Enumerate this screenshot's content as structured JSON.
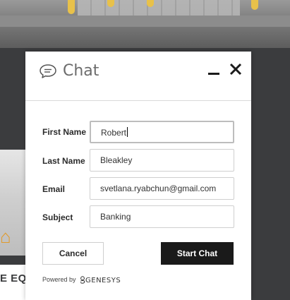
{
  "background": {
    "partial_text": "E EQU",
    "house_icon": "house-icon"
  },
  "chat": {
    "title": "Chat",
    "icons": {
      "chat": "chat-bubble-icon",
      "minimize": "minimize-icon",
      "close": "close-icon"
    },
    "fields": [
      {
        "label": "First Name",
        "value": "Robert"
      },
      {
        "label": "Last Name",
        "value": "Bleakley"
      },
      {
        "label": "Email",
        "value": "svetlana.ryabchun@gmail.com"
      },
      {
        "label": "Subject",
        "value": "Banking"
      }
    ],
    "cancel_label": "Cancel",
    "start_label": "Start Chat",
    "powered_by": "Powered by",
    "brand": "GENESYS"
  },
  "colors": {
    "primary_button": "#1a1a1a",
    "title_gray": "#6b6b6b",
    "backdrop": "#3b3c3e"
  }
}
